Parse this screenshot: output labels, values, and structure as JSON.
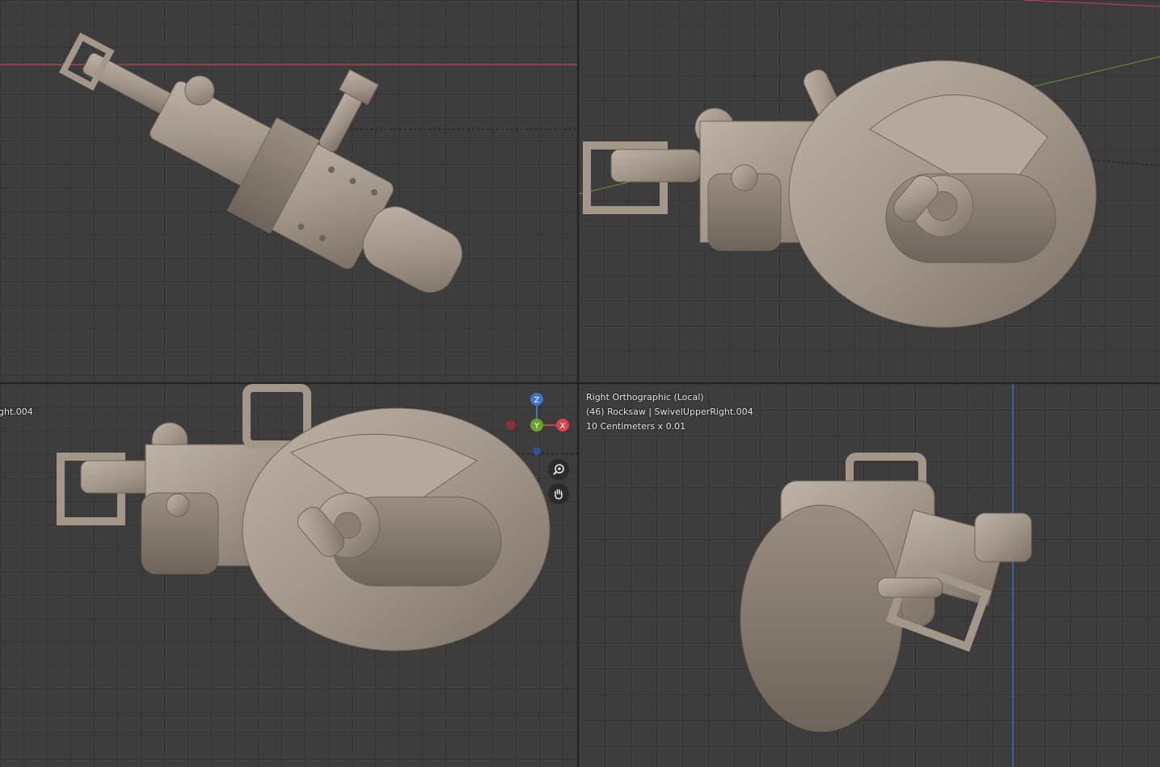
{
  "colors": {
    "grid_bg": "#3d3d3d",
    "grid_line": "#353535",
    "x_axis": "#c4424f",
    "y_axis": "#6a9a2c",
    "z_axis": "#3f74c8",
    "model": "#a3978a"
  },
  "viewports": {
    "top_left": {
      "type": "perspective"
    },
    "top_right": {
      "type": "perspective"
    },
    "bottom_left": {
      "overlay_fragment": "ght.004",
      "gizmo": {
        "z": "Z",
        "y": "Y",
        "x": "X"
      },
      "zoom_icon": "zoom-in-icon",
      "pan_icon": "hand-pan-icon"
    },
    "bottom_right": {
      "overlay_line1": "Right Orthographic (Local)",
      "overlay_line2": "(46) Rocksaw | SwivelUpperRight.004",
      "overlay_line3": "10 Centimeters x 0.01"
    }
  }
}
